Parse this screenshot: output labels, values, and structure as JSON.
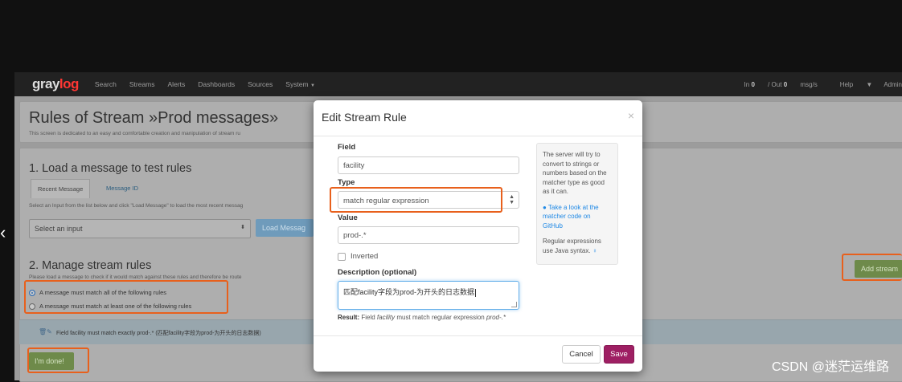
{
  "navbar": {
    "logo_a": "gray",
    "logo_b": "log",
    "items": [
      "Search",
      "Streams",
      "Alerts",
      "Dashboards",
      "Sources",
      "System"
    ],
    "throughput_prefix": "In ",
    "throughput_value": "0",
    "throughput_mid": " / Out ",
    "throughput_out": "0",
    "throughput_suffix": " msg/s",
    "help": "Help",
    "user": "Admin"
  },
  "page": {
    "title": "Rules of Stream »Prod messages»",
    "subtitle": "This screen is dedicated to an easy and comfortable creation and manipulation of stream ru",
    "section1_title": "1. Load a message to test rules",
    "tab_recent": "Recent Message",
    "tab_id": "Message ID",
    "section1_help": "Select an Input from the list below and click \"Load Message\" to load the most recent messag",
    "select_input_placeholder": "Select an input",
    "load_message_button": "Load Messag",
    "section2_title": "2. Manage stream rules",
    "section2_help": "Please load a message to check if it would match against these rules and therefore be route",
    "match_all": "A message must match all of the following rules",
    "match_any": "A message must match at least one of the following rules",
    "rule_text": "Field facility must match exactly prod-.* (匹配facility字段为prod-为开头的日志数据)",
    "done_button": "I'm done!",
    "add_stream_button": "Add stream"
  },
  "modal": {
    "title": "Edit Stream Rule",
    "close": "×",
    "field_label": "Field",
    "field_value": "facility",
    "type_label": "Type",
    "type_value": "match regular expression",
    "value_label": "Value",
    "value_value": "prod-.*",
    "inverted_label": "Inverted",
    "description_label": "Description (optional)",
    "description_value": "匹配facility字段为prod-为开头的日志数据",
    "result_label": "Result:",
    "result_text_a": " Field ",
    "result_field": "facility",
    "result_text_b": " must match regular expression ",
    "result_value": "prod-.*",
    "help_text_1": "The server will try to convert to strings or numbers based on the matcher type as good as it can.",
    "help_link": "Take a look at the matcher code on GitHub",
    "help_text_2": "Regular expressions use Java syntax.",
    "cancel_button": "Cancel",
    "save_button": "Save"
  },
  "watermark": "CSDN @迷茫运维路",
  "colors": {
    "accent_save": "#9e1f63",
    "annotation": "#e8601c",
    "link": "#1e88e5",
    "logo_highlight": "#ff3633"
  }
}
